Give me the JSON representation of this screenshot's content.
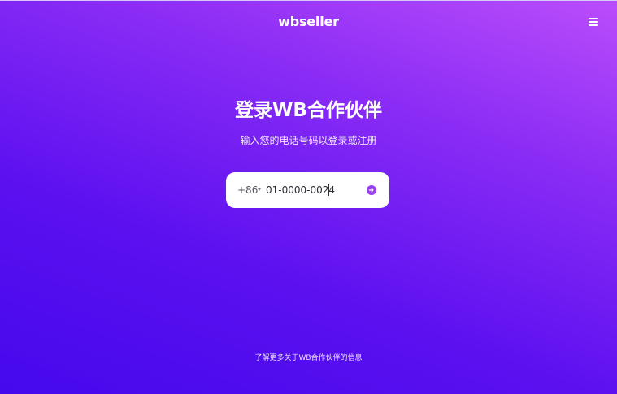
{
  "header": {
    "logo_text": "wbseller",
    "menu_icon": "hamburger-menu-icon"
  },
  "main": {
    "title": "登录WB合作伙伴",
    "subtitle": "输入您的电话号码以登录或注册",
    "phone": {
      "country_code": "+86",
      "value": "01-0000-0024",
      "submit_icon": "arrow-right-icon"
    }
  },
  "footer": {
    "link_text": "了解更多关于WB合作伙伴的信息"
  },
  "colors": {
    "gradient_top": "#bb4dfb",
    "gradient_bottom": "#4409ec",
    "accent": "#9b3cf7"
  }
}
